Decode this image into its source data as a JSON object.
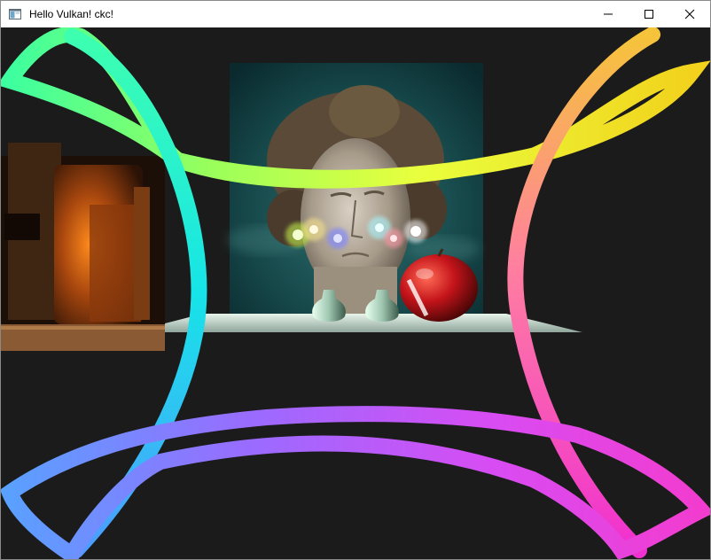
{
  "window": {
    "title": "Hello Vulkan! ckc!",
    "buttons": {
      "minimize_icon": "minimize-icon",
      "maximize_icon": "maximize-icon",
      "close_icon": "close-icon"
    }
  },
  "scene": {
    "background_color": "#1b1b1b",
    "objects": [
      "torus-knot-particles",
      "sculpture-backdrop",
      "apple",
      "vase-left",
      "vase-right",
      "wooden-cabinet",
      "light-orbs",
      "floor-plane"
    ],
    "orb_colors": [
      "#b8e04a",
      "#f4e38c",
      "#7f86ff",
      "#a8f6ff",
      "#ff9aa8",
      "#ffffff"
    ]
  }
}
